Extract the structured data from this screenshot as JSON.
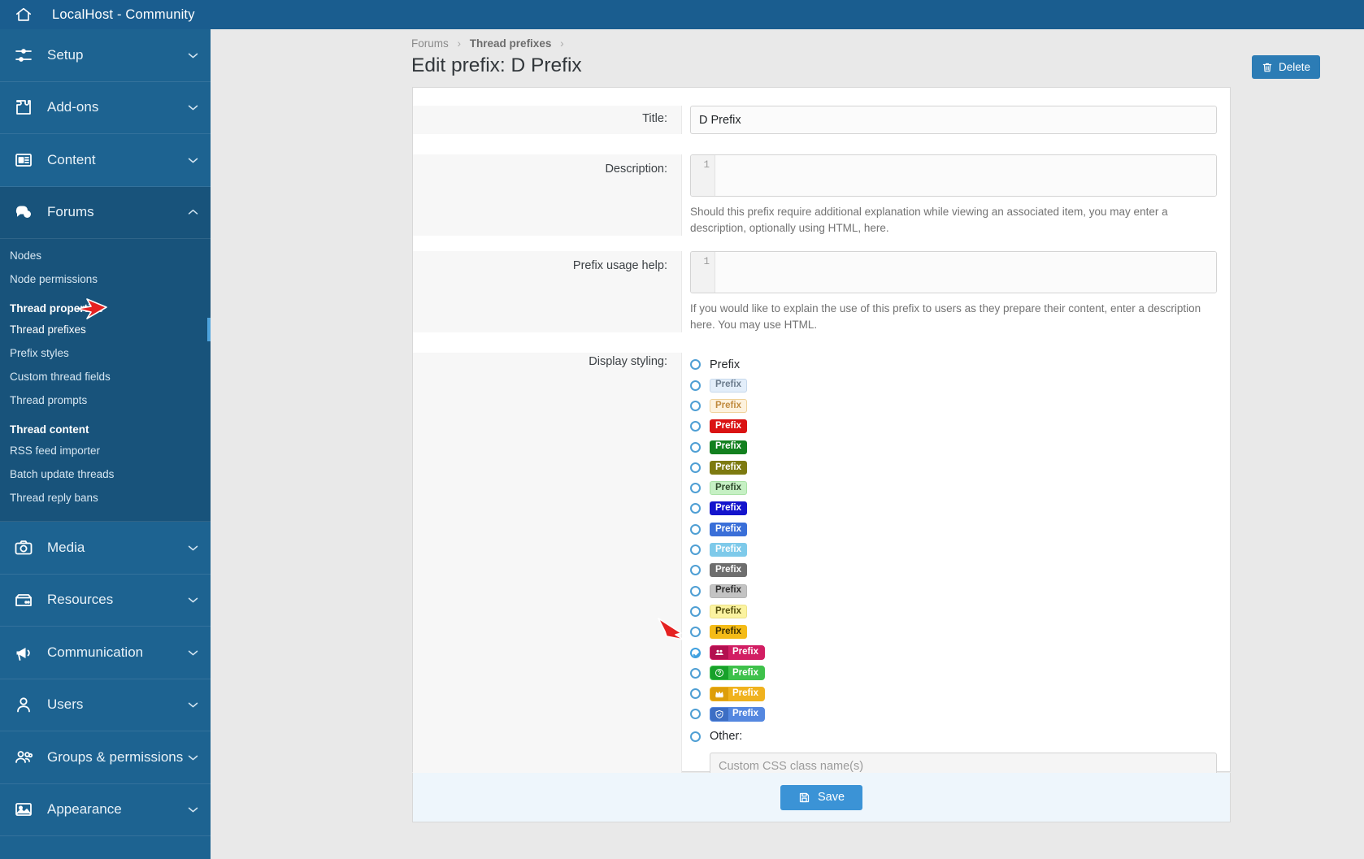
{
  "topbar": {
    "home_icon": "home-icon",
    "title": "LocalHost - Community"
  },
  "sidebar": {
    "groups": [
      {
        "label": "Setup",
        "icon": "sliders-icon",
        "chevron": "chevron-down-icon",
        "expanded": false
      },
      {
        "label": "Add-ons",
        "icon": "puzzle-icon",
        "chevron": "chevron-down-icon",
        "expanded": false
      },
      {
        "label": "Content",
        "icon": "article-icon",
        "chevron": "chevron-down-icon",
        "expanded": false
      },
      {
        "label": "Forums",
        "icon": "comments-icon",
        "chevron": "chevron-up-icon",
        "expanded": true
      },
      {
        "label": "Media",
        "icon": "camera-icon",
        "chevron": "chevron-down-icon",
        "expanded": false
      },
      {
        "label": "Resources",
        "icon": "archive-icon",
        "chevron": "chevron-down-icon",
        "expanded": false
      },
      {
        "label": "Communication",
        "icon": "megaphone-icon",
        "chevron": "chevron-down-icon",
        "expanded": false
      },
      {
        "label": "Users",
        "icon": "user-icon",
        "chevron": "chevron-down-icon",
        "expanded": false
      },
      {
        "label": "Groups & permissions",
        "icon": "users-icon",
        "chevron": "chevron-down-icon",
        "expanded": false
      },
      {
        "label": "Appearance",
        "icon": "image-icon",
        "chevron": "chevron-down-icon",
        "expanded": false
      }
    ],
    "forums_sub": [
      {
        "type": "item",
        "label": "Nodes",
        "active": false
      },
      {
        "type": "item",
        "label": "Node permissions",
        "active": false
      },
      {
        "type": "heading",
        "label": "Thread properties"
      },
      {
        "type": "item",
        "label": "Thread prefixes",
        "active": true
      },
      {
        "type": "item",
        "label": "Prefix styles",
        "active": false
      },
      {
        "type": "item",
        "label": "Custom thread fields",
        "active": false
      },
      {
        "type": "item",
        "label": "Thread prompts",
        "active": false
      },
      {
        "type": "heading",
        "label": "Thread content"
      },
      {
        "type": "item",
        "label": "RSS feed importer",
        "active": false
      },
      {
        "type": "item",
        "label": "Batch update threads",
        "active": false
      },
      {
        "type": "item",
        "label": "Thread reply bans",
        "active": false
      }
    ]
  },
  "breadcrumb": {
    "items": [
      "Forums",
      "Thread prefixes"
    ],
    "separator": "›"
  },
  "page": {
    "title": "Edit prefix: D Prefix",
    "delete_label": "Delete",
    "delete_icon": "trash-icon",
    "save_label": "Save",
    "save_icon": "save-icon"
  },
  "form": {
    "title_label": "Title:",
    "title_value": "D Prefix",
    "description_label": "Description:",
    "description_value": "",
    "description_gutter": "1",
    "description_hint": "Should this prefix require additional explanation while viewing an associated item, you may enter a description, optionally using HTML, here.",
    "usage_label": "Prefix usage help:",
    "usage_value": "",
    "usage_gutter": "1",
    "usage_hint": "If you would like to explain the use of this prefix to users as they prepare their content, enter a description here. You may use HTML.",
    "styling_label": "Display styling:",
    "other_label": "Other:",
    "custom_css_placeholder": "Custom CSS class name(s)",
    "custom_css_value": ""
  },
  "styling_options": [
    {
      "id": "none",
      "text": "Prefix",
      "chip": false,
      "selected": false
    },
    {
      "id": "primary",
      "text": "Prefix",
      "chip": true,
      "bg": "#e3eefa",
      "fg": "#6b7b8c",
      "border": "#c6d8ec",
      "selected": false
    },
    {
      "id": "secondary",
      "text": "Prefix",
      "chip": true,
      "bg": "#fdf2de",
      "fg": "#c08a3e",
      "border": "#f0d29a",
      "selected": false
    },
    {
      "id": "red",
      "text": "Prefix",
      "chip": true,
      "bg": "#da1313",
      "fg": "#ffffff",
      "border": "#da1313",
      "selected": false
    },
    {
      "id": "green",
      "text": "Prefix",
      "chip": true,
      "bg": "#13801f",
      "fg": "#ffffff",
      "border": "#13801f",
      "selected": false
    },
    {
      "id": "olive",
      "text": "Prefix",
      "chip": true,
      "bg": "#7d7a10",
      "fg": "#ffffff",
      "border": "#7d7a10",
      "selected": false
    },
    {
      "id": "lightgreen",
      "text": "Prefix",
      "chip": true,
      "bg": "#c6f0c4",
      "fg": "#2f4a2c",
      "border": "#a9e2a6",
      "selected": false
    },
    {
      "id": "blue",
      "text": "Prefix",
      "chip": true,
      "bg": "#1414cc",
      "fg": "#ffffff",
      "border": "#1414cc",
      "selected": false
    },
    {
      "id": "royalblue",
      "text": "Prefix",
      "chip": true,
      "bg": "#3a6fd8",
      "fg": "#ffffff",
      "border": "#3a6fd8",
      "selected": false
    },
    {
      "id": "skyblue",
      "text": "Prefix",
      "chip": true,
      "bg": "#7ecaea",
      "fg": "#ffffff",
      "border": "#7ecaea",
      "selected": false
    },
    {
      "id": "darkgray",
      "text": "Prefix",
      "chip": true,
      "bg": "#6e6e6e",
      "fg": "#ffffff",
      "border": "#6e6e6e",
      "selected": false
    },
    {
      "id": "gray",
      "text": "Prefix",
      "chip": true,
      "bg": "#c3c3c3",
      "fg": "#313131",
      "border": "#b4b4b4",
      "selected": false
    },
    {
      "id": "lightyellow",
      "text": "Prefix",
      "chip": true,
      "bg": "#fbf3a0",
      "fg": "#55500f",
      "border": "#ece288",
      "selected": false
    },
    {
      "id": "amber",
      "text": "Prefix",
      "chip": true,
      "bg": "#f4bb17",
      "fg": "#3c2f00",
      "border": "#f4bb17",
      "selected": false
    },
    {
      "id": "staff",
      "text": "Prefix",
      "chip": true,
      "bg": "#d21e63",
      "fg": "#ffffff",
      "border": "#d21e63",
      "icon": "group-icon",
      "icon_bg": "#b3104f",
      "selected": true
    },
    {
      "id": "question",
      "text": "Prefix",
      "chip": true,
      "bg": "#3ec14b",
      "fg": "#ffffff",
      "border": "#3ec14b",
      "icon": "question-circle-icon",
      "icon_bg": "#17a12a",
      "selected": false
    },
    {
      "id": "premium",
      "text": "Prefix",
      "chip": true,
      "bg": "#f0b21e",
      "fg": "#ffffff",
      "border": "#f0b21e",
      "icon": "crown-icon",
      "icon_bg": "#dd9e0a",
      "selected": false
    },
    {
      "id": "verified",
      "text": "Prefix",
      "chip": true,
      "bg": "#5487e0",
      "fg": "#ffffff",
      "border": "#5487e0",
      "icon": "shield-check-icon",
      "icon_bg": "#3d6ec4",
      "selected": false
    }
  ],
  "colors": {
    "sidebar_bg": "#1d6391",
    "sidebar_open_bg": "#18537b",
    "topbar_bg": "#1a5d8f",
    "accent": "#3b93d6",
    "page_bg": "#e9e9e9"
  }
}
